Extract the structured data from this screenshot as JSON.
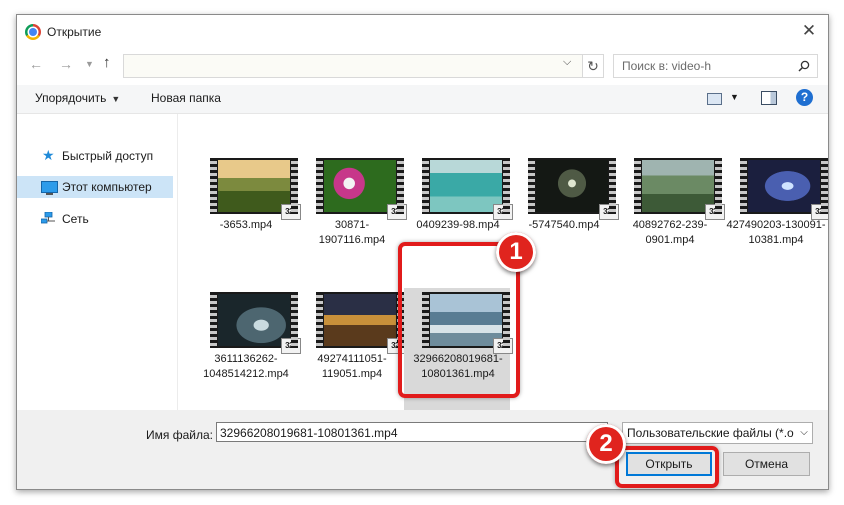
{
  "window": {
    "title": "Открытие"
  },
  "nav": {
    "search_placeholder": "Поиск в: video-h"
  },
  "toolbar": {
    "organize_label": "Упорядочить",
    "new_folder_label": "Новая папка"
  },
  "sidebar": {
    "items": [
      {
        "label": "Быстрый доступ",
        "icon": "star-icon"
      },
      {
        "label": "Этот компьютер",
        "icon": "computer-icon",
        "selected": true
      },
      {
        "label": "Сеть",
        "icon": "network-icon"
      }
    ]
  },
  "files": [
    {
      "name": "-3653.mp4",
      "badge": "321"
    },
    {
      "name": "30871-1907116.mp4",
      "badge": "321"
    },
    {
      "name": "0409239-98.mp4",
      "badge": "321"
    },
    {
      "name": "-5747540.mp4",
      "badge": "321"
    },
    {
      "name": "40892762-239-0901.mp4",
      "badge": "321"
    },
    {
      "name": "427490203-130091-10381.mp4",
      "badge": "321"
    },
    {
      "name": "3611136262-1048514212.mp4",
      "badge": "321"
    },
    {
      "name": "49274111051-119051.mp4",
      "badge": "321"
    },
    {
      "name": "32966208019681-10801361.mp4",
      "badge": "321",
      "selected": true
    }
  ],
  "bottom": {
    "filename_label": "Имя файла:",
    "filename_value": "32966208019681-10801361.mp4",
    "filter_value": "Пользовательские файлы (*.o",
    "open_label": "Открыть",
    "cancel_label": "Отмена"
  },
  "annotations": [
    {
      "number": "1"
    },
    {
      "number": "2"
    }
  ],
  "colors": {
    "accent": "#0078d7",
    "selection": "#cce4f7",
    "annotation": "#e0241e"
  }
}
